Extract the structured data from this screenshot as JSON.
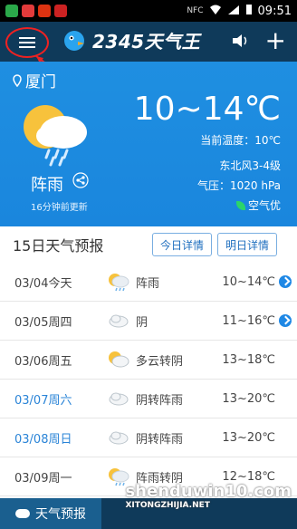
{
  "status_bar": {
    "time": "09:51",
    "nfc": "NFC"
  },
  "app_bar": {
    "brand": "2345天气王"
  },
  "weather": {
    "city": "厦门",
    "condition": "阵雨",
    "updated": "16分钟前更新",
    "temp_range": "10~14℃",
    "current_temp": "当前温度：10℃",
    "wind": "东北风3-4级",
    "pressure": "气压：1020 hPa",
    "aqi": "空气优"
  },
  "forecast": {
    "title": "15日天气预报",
    "today_button": "今日详情",
    "tomorrow_button": "明日详情",
    "rows": [
      {
        "date": "03/04今天",
        "icon": "sun-rain-icon",
        "text": "阵雨",
        "temps": "10~14℃",
        "arrow": true,
        "weekend": false
      },
      {
        "date": "03/05周四",
        "icon": "cloud-icon",
        "text": "阴",
        "temps": "11~16℃",
        "arrow": true,
        "weekend": false
      },
      {
        "date": "03/06周五",
        "icon": "sun-cloud-icon",
        "text": "多云转阴",
        "temps": "13~18℃",
        "arrow": false,
        "weekend": false
      },
      {
        "date": "03/07周六",
        "icon": "cloud-icon",
        "text": "阴转阵雨",
        "temps": "13~20℃",
        "arrow": false,
        "weekend": true
      },
      {
        "date": "03/08周日",
        "icon": "cloud-icon",
        "text": "阴转阵雨",
        "temps": "13~20℃",
        "arrow": false,
        "weekend": true
      },
      {
        "date": "03/09周一",
        "icon": "sun-rain-icon",
        "text": "阵雨转阴",
        "temps": "12~18℃",
        "arrow": false,
        "weekend": false
      }
    ]
  },
  "bottom_nav": {
    "active_tab": "天气预报"
  },
  "watermark": {
    "main": "shenduwin10.com",
    "sub": "XITONGZHIJIA.NET"
  }
}
